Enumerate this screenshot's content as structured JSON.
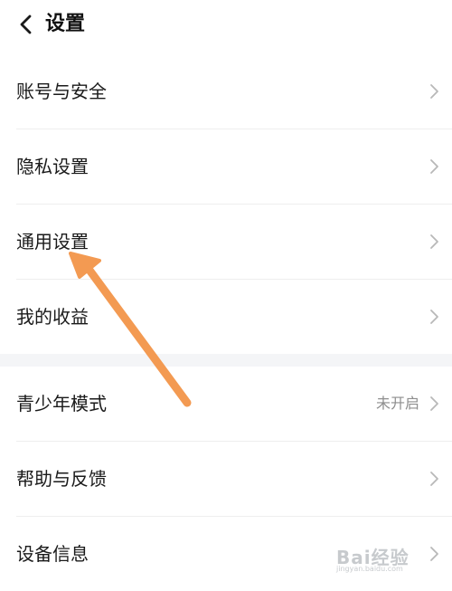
{
  "header": {
    "title": "设置",
    "back_icon": "chevron-left-icon"
  },
  "settings": {
    "group1": [
      {
        "label": "账号与安全"
      },
      {
        "label": "隐私设置"
      },
      {
        "label": "通用设置"
      },
      {
        "label": "我的收益"
      }
    ],
    "group2": [
      {
        "label": "青少年模式",
        "value": "未开启"
      },
      {
        "label": "帮助与反馈"
      },
      {
        "label": "设备信息"
      }
    ]
  },
  "annotation": {
    "arrow_color": "#f39a52",
    "points_to": "通用设置"
  },
  "watermark": {
    "text": "Bai经验",
    "subtext": "jingyan.baidu.com"
  },
  "colors": {
    "text": "#1a1a1a",
    "secondary_text": "#8e8e8e",
    "chevron": "#b8b8b8",
    "section_gap": "#f4f5f7",
    "divider": "#eeeeee"
  }
}
